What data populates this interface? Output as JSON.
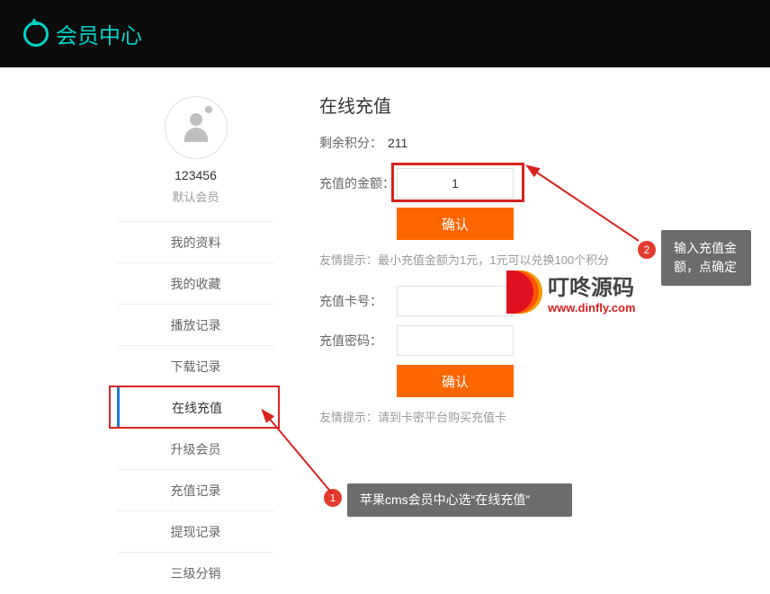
{
  "header": {
    "title": "会员中心"
  },
  "user": {
    "name": "123456",
    "role": "默认会员"
  },
  "sidebar": {
    "items": [
      {
        "label": "我的资料"
      },
      {
        "label": "我的收藏"
      },
      {
        "label": "播放记录"
      },
      {
        "label": "下载记录"
      },
      {
        "label": "在线充值"
      },
      {
        "label": "升级会员"
      },
      {
        "label": "充值记录"
      },
      {
        "label": "提现记录"
      },
      {
        "label": "三级分销"
      }
    ],
    "active_index": 4
  },
  "page": {
    "title": "在线充值",
    "points_label": "剩余积分：",
    "points_value": "211",
    "amount_label": "充值的金额：",
    "amount_value": "1",
    "confirm1": "确认",
    "hint1": "友情提示：最小充值金额为1元，1元可以兑换100个积分",
    "card_no_label": "充值卡号：",
    "card_no_value": "",
    "card_pw_label": "充值密码：",
    "card_pw_value": "",
    "confirm2": "确认",
    "hint2": "友情提示：请到卡密平台购买充值卡"
  },
  "callouts": {
    "c1_num": "1",
    "c1_text": "苹果cms会员中心选“在线充值”",
    "c2_num": "2",
    "c2_text": "输入充值金额，点确定"
  },
  "watermark": {
    "main": "叮咚源码",
    "url": "www.dinfly.com"
  }
}
